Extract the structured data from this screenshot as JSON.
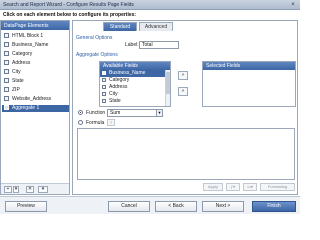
{
  "window": {
    "title": "Search and Report Wizard - Configure Results Page Fields",
    "close_glyph": "×"
  },
  "instruction": "Click on each element below to configure its properties:",
  "left_panel": {
    "header": "DataPage Elements",
    "items": [
      {
        "label": "HTML Block 1",
        "selected": false
      },
      {
        "label": "Business_Name",
        "selected": false
      },
      {
        "label": "Category",
        "selected": false
      },
      {
        "label": "Address",
        "selected": false
      },
      {
        "label": "City",
        "selected": false
      },
      {
        "label": "State",
        "selected": false
      },
      {
        "label": "ZIP",
        "selected": false
      },
      {
        "label": "Website_Address",
        "selected": false
      },
      {
        "label": "Aggregate 1",
        "selected": true
      }
    ],
    "footer": {
      "add": "+",
      "add_dropdown": "▾",
      "delete": "✕",
      "more": "▾"
    }
  },
  "tabs": [
    {
      "label": "Standard",
      "active": true
    },
    {
      "label": "Advanced",
      "active": false
    }
  ],
  "general_options": {
    "section": "General Options",
    "label_caption": "Label:",
    "label_value": "Total"
  },
  "aggregate_options": {
    "section": "Aggregate Options",
    "available_header": "Available Fields",
    "selected_header": "Selected Fields",
    "available_fields": [
      {
        "label": "Business_Name",
        "selected": true
      },
      {
        "label": "Category",
        "selected": false
      },
      {
        "label": "Address",
        "selected": false
      },
      {
        "label": "City",
        "selected": false
      },
      {
        "label": "State",
        "selected": false
      }
    ],
    "add_arrow": "»",
    "remove_arrow": "«",
    "function_label": "Function",
    "function_value": "Sum",
    "formula_label": "Formula",
    "function_selected": true
  },
  "formula_toolbar": {
    "apply": "Apply",
    "formatting": "Formatting"
  },
  "footer_buttons": {
    "preview": "Preview",
    "cancel": "Cancel",
    "back": "< Back",
    "next": "Next >",
    "finish": "Finish"
  }
}
